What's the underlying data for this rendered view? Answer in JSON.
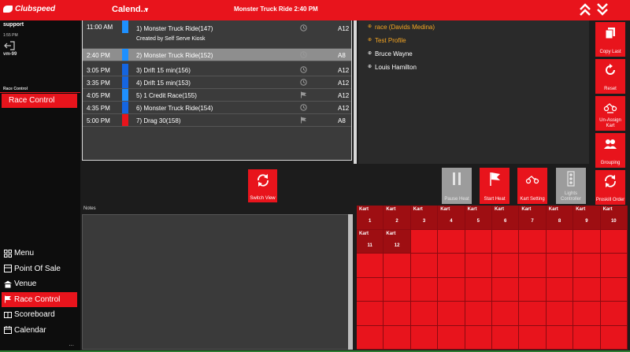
{
  "header": {
    "brand": "Clubspeed",
    "calendar_title": "Calend...",
    "heat_title": "Monster Truck Ride 2:40 PM"
  },
  "user": {
    "name": "support",
    "time": "1:55 PM",
    "version": "vm-99"
  },
  "sidebar": {
    "section_label": "Race Control",
    "section_button": "Race Control",
    "nav": [
      {
        "label": "Menu",
        "icon": "grid-icon"
      },
      {
        "label": "Point Of Sale",
        "icon": "pos-icon"
      },
      {
        "label": "Venue",
        "icon": "venue-icon"
      },
      {
        "label": "Race Control",
        "icon": "flag-icon",
        "active": true
      },
      {
        "label": "Scoreboard",
        "icon": "scoreboard-icon"
      },
      {
        "label": "Calendar",
        "icon": "calendar-icon"
      }
    ],
    "more": "..."
  },
  "heats": {
    "rows": [
      {
        "time": "11:00 AM",
        "name": "1) Monster Truck Ride(147)",
        "sub": "Created by Self Serve Kiosk",
        "track": "A12",
        "color": "#1e90ff",
        "icon": "clock-icon"
      },
      {
        "time": "2:40 PM",
        "name": "2) Monster Truck Ride(152)",
        "track": "A8",
        "color": "#1e90ff",
        "icon": "clock-icon",
        "selected": true
      },
      {
        "time": "3:05 PM",
        "name": "3) Drift 15 min(156)",
        "track": "A12",
        "color": "#1565e0",
        "icon": "clock-icon"
      },
      {
        "time": "3:35 PM",
        "name": "4) Drift 15 min(153)",
        "track": "A12",
        "color": "#1565e0",
        "icon": "clock-icon"
      },
      {
        "time": "4:05 PM",
        "name": "5) 1 Credit Race(155)",
        "track": "A12",
        "color": "#1e90ff",
        "icon": "flag-icon"
      },
      {
        "time": "4:35 PM",
        "name": "6) Monster Truck Ride(154)",
        "track": "A12",
        "color": "#1565e0",
        "icon": "clock-icon"
      },
      {
        "time": "5:00 PM",
        "name": "7) Drag 30(158)",
        "track": "A8",
        "color": "#e8141c",
        "icon": "flag-icon"
      }
    ]
  },
  "racers": [
    {
      "name": "race (Davids Medina)",
      "highlight": true
    },
    {
      "name": "Test Profile",
      "highlight": true
    },
    {
      "name": "Bruce Wayne",
      "highlight": false
    },
    {
      "name": "Louis Hamilton",
      "highlight": false
    }
  ],
  "right_buttons": {
    "copy_last": "Copy Last",
    "reset": "Reset",
    "unassign": "Un-Assign Kart",
    "grouping": "Grouping",
    "proskill": "Proskill Order"
  },
  "controls": {
    "switch_view": "Switch View",
    "pause_heat": "Pause Heat",
    "start_heat": "Start Heat",
    "kart_setting": "Kart Setting",
    "lights_controller": "Lights Controller"
  },
  "notes": {
    "label": "Notes"
  },
  "karts": {
    "label": "Kart",
    "numbers": [
      "1",
      "2",
      "3",
      "4",
      "5",
      "6",
      "7",
      "8",
      "9",
      "10",
      "11",
      "12"
    ]
  }
}
